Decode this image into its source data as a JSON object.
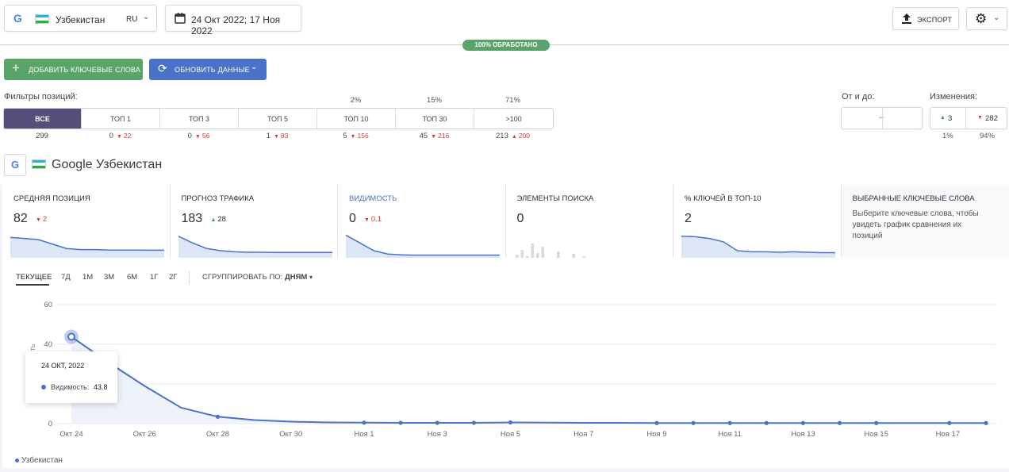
{
  "header": {
    "region_name": "Узбекистан",
    "lang": "RU",
    "date_range": "24 Окт 2022; 17 Ноя 2022",
    "export_label": "ЭКСПОРТ",
    "processed_badge": "100% ОБРАБОТАНО"
  },
  "actions": {
    "add_keywords": "ДОБАВИТЬ КЛЮЧЕВЫЕ СЛОВА",
    "refresh": "ОБНОВИТЬ ДАННЫЕ"
  },
  "filters": {
    "label": "Фильтры позиций:",
    "tabs": [
      {
        "label": "ВСЕ",
        "pct": "",
        "count": "299",
        "delta": "",
        "dir": ""
      },
      {
        "label": "ТОП 1",
        "pct": "",
        "count": "0",
        "delta": "22",
        "dir": "down"
      },
      {
        "label": "ТОП 3",
        "pct": "",
        "count": "0",
        "delta": "56",
        "dir": "down"
      },
      {
        "label": "ТОП 5",
        "pct": "",
        "count": "1",
        "delta": "83",
        "dir": "down"
      },
      {
        "label": "ТОП 10",
        "pct": "2%",
        "count": "5",
        "delta": "156",
        "dir": "down"
      },
      {
        "label": "ТОП 30",
        "pct": "15%",
        "count": "45",
        "delta": "216",
        "dir": "down"
      },
      {
        "label": ">100",
        "pct": "71%",
        "count": "213",
        "delta": "200",
        "dir": "up"
      }
    ],
    "range_label": "От и до:",
    "range_sep": "–",
    "changes_label": "Изменения:",
    "changes_up": "3",
    "changes_down": "282",
    "changes_up_pct": "1%",
    "changes_down_pct": "94%"
  },
  "engine": {
    "title": "Google Узбекистан"
  },
  "metrics": [
    {
      "title": "СРЕДНЯЯ ПОЗИЦИЯ",
      "value": "82",
      "delta": "2",
      "dir": "down"
    },
    {
      "title": "ПРОГНОЗ ТРАФИКА",
      "value": "183",
      "delta": "28",
      "dir": "up"
    },
    {
      "title": "ВИДИМОСТЬ",
      "value": "0",
      "delta": "0.1",
      "dir": "down"
    },
    {
      "title": "ЭЛЕМЕНТЫ ПОИСКА",
      "value": "0",
      "delta": "",
      "dir": ""
    },
    {
      "title": "% КЛЮЧЕЙ В ТОП-10",
      "value": "2",
      "delta": "",
      "dir": ""
    },
    {
      "title": "ВЫБРАННЫЕ КЛЮЧЕВЫЕ СЛОВА",
      "hint": "Выберите ключевые слова, чтобы увидеть график сравнения их позиций"
    }
  ],
  "periods": [
    "ТЕКУЩЕЕ",
    "7Д",
    "1М",
    "3М",
    "6М",
    "1Г",
    "2Г"
  ],
  "group_by": {
    "label": "СГРУППИРОВАТЬ ПО:",
    "value": "ДНЯМ"
  },
  "tooltip": {
    "date": "24 ОКТ, 2022",
    "label": "Видимость:",
    "value": "43.8"
  },
  "colors": {
    "accent": "#4a72c9",
    "green": "#5aa46a",
    "purple": "#564d7a",
    "line": "#4a72c9"
  },
  "chart_data": {
    "type": "line",
    "ylabel": "ть",
    "ylim": [
      0,
      60
    ],
    "y_ticks": [
      "0",
      "20",
      "40",
      "60"
    ],
    "x_ticks": [
      "Окт 24",
      "Окт 26",
      "Окт 28",
      "Окт 30",
      "Ноя 1",
      "Ноя 3",
      "Ноя 5",
      "Ноя 7",
      "Ноя 9",
      "Ноя 11",
      "Ноя 13",
      "Ноя 15",
      "Ноя 17"
    ],
    "x_days": [
      0,
      1,
      2,
      3,
      4,
      5,
      6,
      7,
      8,
      9,
      10,
      11,
      12,
      13,
      14,
      15,
      16,
      17,
      18,
      19,
      20,
      21,
      22,
      23,
      24,
      25
    ],
    "series": [
      {
        "name": "Узбекистан",
        "values": [
          43.8,
          31,
          19,
          8,
          3.5,
          1.8,
          1.0,
          0.6,
          0.5,
          0.4,
          0.4,
          0.4,
          0.6,
          0.5,
          0.4,
          0.4,
          0.3,
          0.3,
          0.3,
          0.3,
          0.3,
          0.3,
          0.3,
          0.3,
          0.3,
          0.3
        ]
      }
    ],
    "marked_days": [
      0,
      4,
      8,
      9,
      10,
      11,
      12,
      16,
      17,
      18,
      19,
      20,
      21,
      22,
      24,
      25
    ]
  }
}
